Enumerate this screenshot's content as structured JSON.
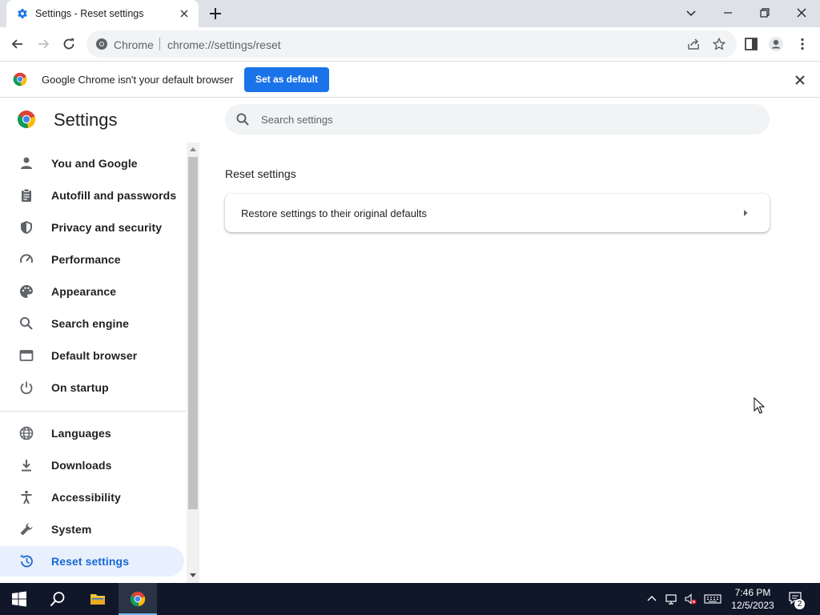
{
  "browser": {
    "tab_title": "Settings - Reset settings",
    "omnibox_site": "Chrome",
    "omnibox_url": "chrome://settings/reset"
  },
  "infobar": {
    "message": "Google Chrome isn't your default browser",
    "button_label": "Set as default"
  },
  "settings": {
    "title": "Settings",
    "search_placeholder": "Search settings",
    "nav_items": [
      {
        "label": "You and Google",
        "icon": "person-icon"
      },
      {
        "label": "Autofill and passwords",
        "icon": "clipboard-icon"
      },
      {
        "label": "Privacy and security",
        "icon": "shield-icon"
      },
      {
        "label": "Performance",
        "icon": "speedometer-icon"
      },
      {
        "label": "Appearance",
        "icon": "palette-icon"
      },
      {
        "label": "Search engine",
        "icon": "search-icon"
      },
      {
        "label": "Default browser",
        "icon": "browser-window-icon"
      },
      {
        "label": "On startup",
        "icon": "power-icon"
      },
      {
        "label": "Languages",
        "icon": "globe-icon"
      },
      {
        "label": "Downloads",
        "icon": "download-icon"
      },
      {
        "label": "Accessibility",
        "icon": "accessibility-icon"
      },
      {
        "label": "System",
        "icon": "wrench-icon"
      },
      {
        "label": "Reset settings",
        "icon": "history-icon",
        "active": true
      }
    ],
    "section_title": "Reset settings",
    "restore_label": "Restore settings to their original defaults"
  },
  "taskbar": {
    "time": "7:46 PM",
    "date": "12/5/2023",
    "notification_count": "2"
  },
  "colors": {
    "accent": "#1a73e8",
    "active_nav_bg": "#e8f0fe",
    "active_nav_text": "#1967d2",
    "taskbar_bg": "#0f1729"
  }
}
